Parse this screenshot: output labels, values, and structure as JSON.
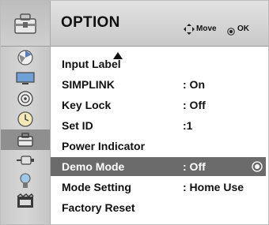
{
  "menu": {
    "title": "OPTION",
    "icon": "option-toolbox-icon"
  },
  "hints": {
    "move_label": "Move",
    "move_icon": "four-way-arrow-icon",
    "ok_label": "OK",
    "ok_icon": "ok-button-icon"
  },
  "sidebar": {
    "items": [
      {
        "name": "picture-icon"
      },
      {
        "name": "screen-icon"
      },
      {
        "name": "audio-icon"
      },
      {
        "name": "time-icon"
      },
      {
        "name": "option-icon",
        "selected": true
      },
      {
        "name": "input-plug-icon"
      },
      {
        "name": "usb-icon"
      },
      {
        "name": "media-icon"
      }
    ]
  },
  "scroll_indicator": "up-arrow-icon",
  "items": [
    {
      "label": "Input Label",
      "value": ""
    },
    {
      "label": "SIMPLINK",
      "value": ": On"
    },
    {
      "label": "Key Lock",
      "value": ": Off"
    },
    {
      "label": "Set ID",
      "value": ":1"
    },
    {
      "label": "Power Indicator",
      "value": ""
    },
    {
      "label": "Demo Mode",
      "value": ": Off",
      "selected": true
    },
    {
      "label": "Mode Setting",
      "value": ": Home Use"
    },
    {
      "label": "Factory Reset",
      "value": ""
    }
  ],
  "colors": {
    "selected_row": "#6b6b6b",
    "selected_text": "#ffffff",
    "text": "#111111"
  }
}
